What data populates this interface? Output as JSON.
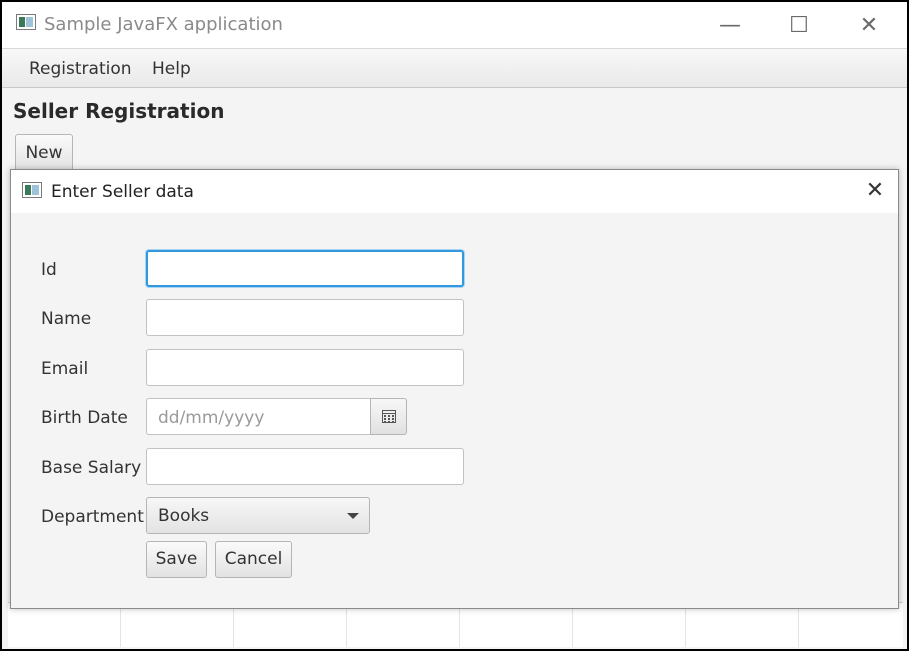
{
  "main_window": {
    "title": "Sample JavaFX application",
    "controls": {
      "minimize": "—",
      "maximize": "☐",
      "close": "✕"
    }
  },
  "menubar": {
    "items": [
      {
        "label": "Registration"
      },
      {
        "label": "Help"
      }
    ]
  },
  "page": {
    "title": "Seller Registration",
    "new_button": "New"
  },
  "dialog": {
    "title": "Enter Seller data",
    "close": "✕",
    "fields": {
      "id": {
        "label": "Id",
        "value": ""
      },
      "name": {
        "label": "Name",
        "value": ""
      },
      "email": {
        "label": "Email",
        "value": ""
      },
      "birth_date": {
        "label": "Birth Date",
        "placeholder": "dd/mm/yyyy",
        "value": ""
      },
      "base_salary": {
        "label": "Base Salary",
        "value": ""
      },
      "department": {
        "label": "Department",
        "selected": "Books"
      }
    },
    "buttons": {
      "save": "Save",
      "cancel": "Cancel"
    }
  },
  "colors": {
    "focus_border": "#3399dd",
    "window_bg": "#f4f4f4"
  },
  "icons": {
    "app": "javafx-app-icon",
    "calendar": "calendar-icon",
    "dropdown": "chevron-down-icon"
  }
}
